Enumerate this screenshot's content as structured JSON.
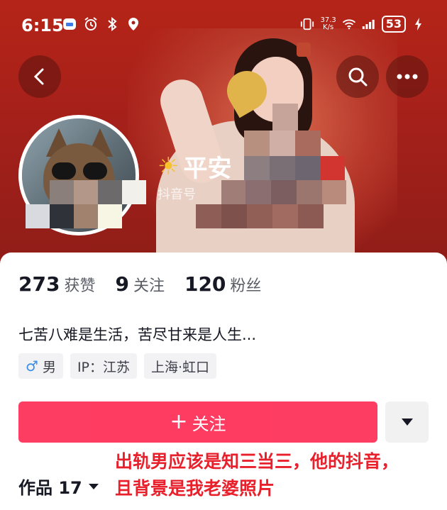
{
  "status_bar": {
    "time": "6:15",
    "net_speed_value": "37.3",
    "net_speed_unit": "K/s",
    "battery": "53"
  },
  "profile": {
    "name_visible": "平安",
    "id_label": "抖音号"
  },
  "stats": [
    {
      "value": "273",
      "label": "获赞"
    },
    {
      "value": "9",
      "label": "关注"
    },
    {
      "value": "120",
      "label": "粉丝"
    }
  ],
  "bio": "七苦八难是生活，苦尽甘来是人生...",
  "tags": {
    "gender_symbol": "♂",
    "gender": "男",
    "ip": "IP：江苏",
    "location": "上海·虹口"
  },
  "follow_button": {
    "plus": "+",
    "label": "关注"
  },
  "works": {
    "label": "作品 17"
  },
  "annotation": {
    "line1": "出轨男应该是知三当三，他的抖音，",
    "line2": "且背景是我老婆照片"
  },
  "colors": {
    "banner": "#a5201a",
    "follow": "#fe2c55",
    "annotation": "#e8202c"
  }
}
